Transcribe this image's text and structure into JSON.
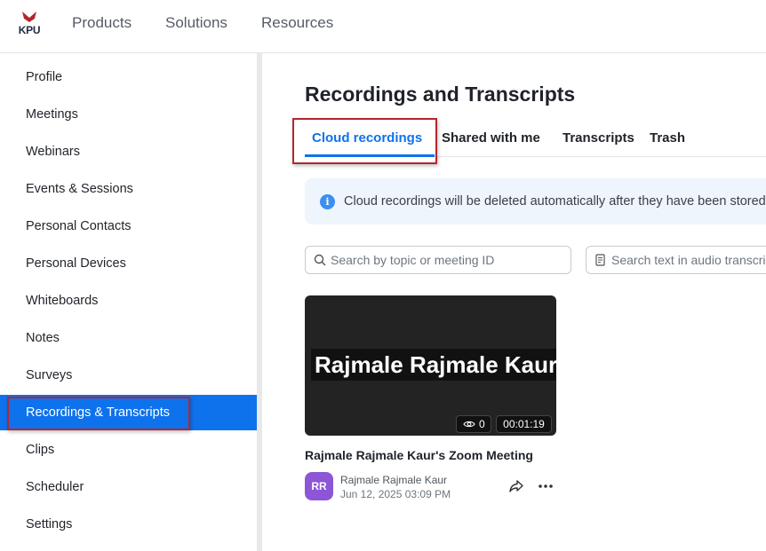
{
  "brand": {
    "logo_text": "KPU",
    "logo_icon": "kpu-logo-icon",
    "accent": "#0e72ed",
    "highlight": "#b3262d"
  },
  "topnav": {
    "items": [
      {
        "label": "Products"
      },
      {
        "label": "Solutions"
      },
      {
        "label": "Resources"
      }
    ]
  },
  "sidebar": {
    "items": [
      {
        "label": "Profile"
      },
      {
        "label": "Meetings"
      },
      {
        "label": "Webinars"
      },
      {
        "label": "Events & Sessions"
      },
      {
        "label": "Personal Contacts"
      },
      {
        "label": "Personal Devices"
      },
      {
        "label": "Whiteboards"
      },
      {
        "label": "Notes"
      },
      {
        "label": "Surveys"
      },
      {
        "label": "Recordings & Transcripts",
        "active": true
      },
      {
        "label": "Clips"
      },
      {
        "label": "Scheduler"
      },
      {
        "label": "Settings"
      }
    ]
  },
  "main": {
    "title": "Recordings and Transcripts",
    "tabs": [
      {
        "label": "Cloud recordings",
        "active": true
      },
      {
        "label": "Shared with me"
      },
      {
        "label": "Transcripts"
      },
      {
        "label": "Trash"
      }
    ],
    "banner": {
      "icon": "info-icon",
      "text": "Cloud recordings will be deleted automatically after they have been stored for"
    },
    "search": {
      "topic_placeholder": "Search by topic or meeting ID",
      "transcript_placeholder": "Search text in audio transcript"
    },
    "recording": {
      "thumbnail_name": "Rajmale Rajmale Kaur",
      "views": "0",
      "duration": "00:01:19",
      "title": "Rajmale Rajmale Kaur's Zoom Meeting",
      "host_initials": "RR",
      "host_name": "Rajmale Rajmale Kaur",
      "date": "Jun 12, 2025 03:09 PM",
      "avatar_color": "#8c56d6"
    }
  }
}
